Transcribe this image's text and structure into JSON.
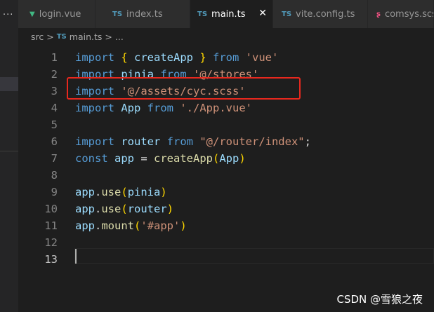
{
  "activity": {
    "more": "..."
  },
  "tabs": [
    {
      "label": "login.vue",
      "icon": "vue-icon",
      "glyph": "▼"
    },
    {
      "label": "index.ts",
      "icon": "typescript-icon",
      "glyph": "TS"
    },
    {
      "label": "main.ts",
      "icon": "typescript-icon",
      "glyph": "TS",
      "active": true
    },
    {
      "label": "vite.config.ts",
      "icon": "typescript-icon",
      "glyph": "TS"
    },
    {
      "label": "comsys.scss",
      "icon": "scss-icon",
      "glyph": "ʂ"
    }
  ],
  "close_glyph": "✕",
  "breadcrumb": {
    "folder": "src",
    "sep": ">",
    "ts": "TS",
    "file": "main.ts",
    "more": "..."
  },
  "code": [
    {
      "n": "1",
      "t": [
        [
          "kw",
          "import "
        ],
        [
          "br1",
          "{ "
        ],
        [
          "vr",
          "createApp "
        ],
        [
          "br1",
          "} "
        ],
        [
          "kw",
          "from "
        ],
        [
          "str",
          "'vue'"
        ]
      ]
    },
    {
      "n": "2",
      "t": [
        [
          "kw",
          "import "
        ],
        [
          "vr",
          "pinia "
        ],
        [
          "kw",
          "from "
        ],
        [
          "str",
          "'@/stores'"
        ]
      ]
    },
    {
      "n": "3",
      "t": [
        [
          "kw",
          "import "
        ],
        [
          "str",
          "'@/assets/cyc.scss'"
        ]
      ]
    },
    {
      "n": "4",
      "t": [
        [
          "kw",
          "import "
        ],
        [
          "vr",
          "App "
        ],
        [
          "kw",
          "from "
        ],
        [
          "str",
          "'./App.vue'"
        ]
      ]
    },
    {
      "n": "5",
      "t": []
    },
    {
      "n": "6",
      "t": [
        [
          "kw",
          "import "
        ],
        [
          "vr",
          "router "
        ],
        [
          "kw",
          "from "
        ],
        [
          "str",
          "\"@/router/index\""
        ],
        [
          "pl",
          ";"
        ]
      ]
    },
    {
      "n": "7",
      "t": [
        [
          "kw",
          "const "
        ],
        [
          "vr",
          "app "
        ],
        [
          "pl",
          "= "
        ],
        [
          "fn",
          "createApp"
        ],
        [
          "br1",
          "("
        ],
        [
          "vr",
          "App"
        ],
        [
          "br1",
          ")"
        ]
      ]
    },
    {
      "n": "8",
      "t": []
    },
    {
      "n": "9",
      "t": [
        [
          "vr",
          "app"
        ],
        [
          "pl",
          "."
        ],
        [
          "fn",
          "use"
        ],
        [
          "br1",
          "("
        ],
        [
          "vr",
          "pinia"
        ],
        [
          "br1",
          ")"
        ]
      ]
    },
    {
      "n": "10",
      "t": [
        [
          "vr",
          "app"
        ],
        [
          "pl",
          "."
        ],
        [
          "fn",
          "use"
        ],
        [
          "br1",
          "("
        ],
        [
          "vr",
          "router"
        ],
        [
          "br1",
          ")"
        ]
      ]
    },
    {
      "n": "11",
      "t": [
        [
          "vr",
          "app"
        ],
        [
          "pl",
          "."
        ],
        [
          "fn",
          "mount"
        ],
        [
          "br1",
          "("
        ],
        [
          "str",
          "'#app'"
        ],
        [
          "br1",
          ")"
        ]
      ]
    },
    {
      "n": "12",
      "t": []
    },
    {
      "n": "13",
      "t": [],
      "current": true
    }
  ],
  "watermark": "CSDN @雪狼之夜",
  "colors": {
    "accent_box": "#e8281e",
    "keyword": "#569cd6",
    "string": "#ce9178"
  }
}
